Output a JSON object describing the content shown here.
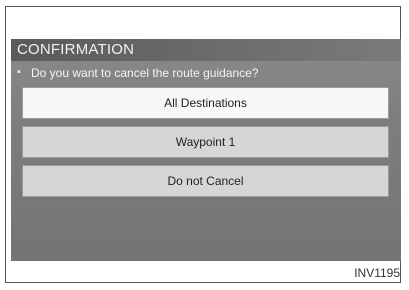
{
  "dialog": {
    "title": "CONFIRMATION",
    "prompt_bullet": "▪",
    "prompt": "Do you want to cancel the route guidance?",
    "options": [
      {
        "label": "All Destinations",
        "state": "selected"
      },
      {
        "label": "Waypoint 1",
        "state": "normal"
      },
      {
        "label": "Do not Cancel",
        "state": "normal"
      }
    ]
  },
  "figure": {
    "code": "INV1195"
  },
  "colors": {
    "screen_background": "#7d7d7d",
    "title_bar": "#6e6e6e",
    "selected_option": "#f7f7f7",
    "option": "#d6d6d6"
  }
}
